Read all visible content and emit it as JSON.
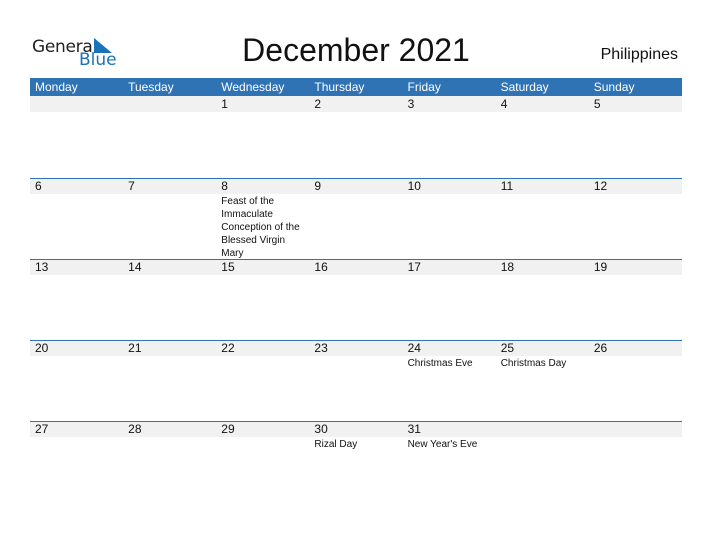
{
  "logo": {
    "general": "General",
    "blue": "Blue"
  },
  "title": "December 2021",
  "country": "Philippines",
  "colors": {
    "accent": "#2f73b4",
    "logo_blue": "#1a73b8",
    "row_shade": "#f1f1f1"
  },
  "weekdays": [
    "Monday",
    "Tuesday",
    "Wednesday",
    "Thursday",
    "Friday",
    "Saturday",
    "Sunday"
  ],
  "weeks": [
    [
      {
        "day": ""
      },
      {
        "day": ""
      },
      {
        "day": "1"
      },
      {
        "day": "2"
      },
      {
        "day": "3"
      },
      {
        "day": "4"
      },
      {
        "day": "5"
      }
    ],
    [
      {
        "day": "6"
      },
      {
        "day": "7"
      },
      {
        "day": "8",
        "event": "Feast of the Immaculate Conception of the Blessed Virgin Mary"
      },
      {
        "day": "9"
      },
      {
        "day": "10"
      },
      {
        "day": "11"
      },
      {
        "day": "12"
      }
    ],
    [
      {
        "day": "13"
      },
      {
        "day": "14"
      },
      {
        "day": "15"
      },
      {
        "day": "16"
      },
      {
        "day": "17"
      },
      {
        "day": "18"
      },
      {
        "day": "19"
      }
    ],
    [
      {
        "day": "20"
      },
      {
        "day": "21"
      },
      {
        "day": "22"
      },
      {
        "day": "23"
      },
      {
        "day": "24",
        "event": "Christmas Eve"
      },
      {
        "day": "25",
        "event": "Christmas Day"
      },
      {
        "day": "26"
      }
    ],
    [
      {
        "day": "27"
      },
      {
        "day": "28"
      },
      {
        "day": "29"
      },
      {
        "day": "30",
        "event": "Rizal Day"
      },
      {
        "day": "31",
        "event": "New Year's Eve"
      },
      {
        "day": ""
      },
      {
        "day": ""
      }
    ]
  ]
}
